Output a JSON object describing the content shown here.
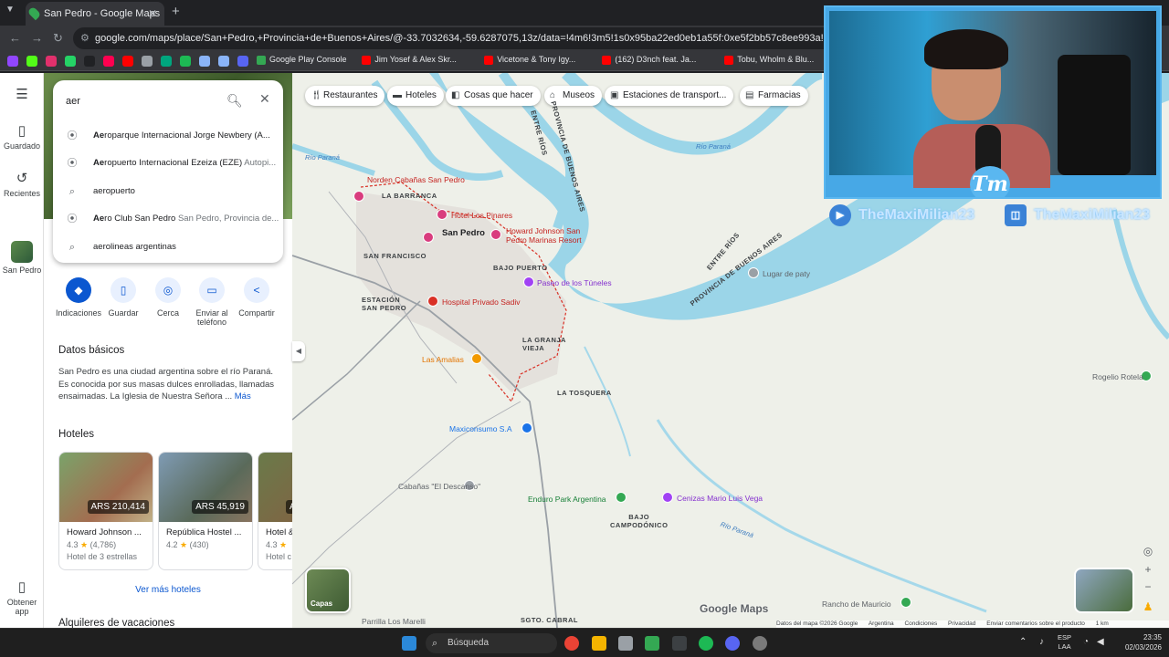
{
  "browser": {
    "tab_title": "San Pedro - Google Maps",
    "url": "google.com/maps/place/San+Pedro,+Provincia+de+Buenos+Aires/@-33.7032634,-59.6287075,13z/data=!4m6!3m5!1s0x95ba22ed0eb1a55f:0xe5f2bb57c8ee993a!8m2!3d-33.6757835!4d-59.6628",
    "bookmarks": [
      {
        "label": "",
        "color": "#9146ff"
      },
      {
        "label": "",
        "color": "#53fc18"
      },
      {
        "label": "",
        "color": "#e1306c"
      },
      {
        "label": "",
        "color": "#25d366"
      },
      {
        "label": "",
        "color": "#202124"
      },
      {
        "label": "",
        "color": "#ff0050"
      },
      {
        "label": "",
        "color": "#ff0000"
      },
      {
        "label": "",
        "color": "#9aa0a6"
      },
      {
        "label": "",
        "color": "#00a67e"
      },
      {
        "label": "",
        "color": "#1db954"
      },
      {
        "label": "",
        "color": "#8ab4f8"
      },
      {
        "label": "",
        "color": "#8ab4f8"
      },
      {
        "label": "",
        "color": "#5865f2"
      },
      {
        "label": "Google Play Console",
        "color": "#34a853"
      },
      {
        "label": "Jim Yosef & Alex Skr...",
        "color": "#ff0000"
      },
      {
        "label": "Vicetone & Tony Igy...",
        "color": "#ff0000"
      },
      {
        "label": "(162) D3nch feat. Ja...",
        "color": "#ff0000"
      },
      {
        "label": "Tobu, Wholm & Blu...",
        "color": "#ff0000"
      },
      {
        "label": "Joel Cor",
        "color": "#ff0000"
      }
    ]
  },
  "stream": {
    "youtube_handle": "TheMaxiMilian23",
    "twitch_handle": "TheMaxiMilian23",
    "logo_text": "Tm"
  },
  "rail": {
    "saved": "Guardado",
    "recent": "Recientes",
    "place": "San Pedro",
    "get_app": "Obtener app"
  },
  "search": {
    "value": "aer",
    "suggestions": [
      {
        "match": "Ae",
        "rest": "roparque Internacional Jorge Newbery (A...",
        "sub": "",
        "icon": "pin"
      },
      {
        "match": "Ae",
        "rest": "ropuerto Internacional Ezeiza (EZE) ",
        "sub": "Autopi...",
        "icon": "pin"
      },
      {
        "match": "ae",
        "rest": "ropuerto",
        "sub": "",
        "icon": "search"
      },
      {
        "match": "Ae",
        "rest": "ro Club San Pedro ",
        "sub": "San Pedro, Provincia de...",
        "icon": "pin"
      },
      {
        "match": "ae",
        "rest": "rolineas argentinas",
        "sub": "",
        "icon": "search"
      }
    ]
  },
  "actions": [
    {
      "label": "Indicaciones",
      "icon": "◆"
    },
    {
      "label": "Guardar",
      "icon": "▯"
    },
    {
      "label": "Cerca",
      "icon": "◎"
    },
    {
      "label": "Enviar al teléfono",
      "icon": "▭"
    },
    {
      "label": "Compartir",
      "icon": "<"
    }
  ],
  "basic": {
    "title": "Datos básicos",
    "text": "San Pedro es una ciudad argentina sobre el río Paraná. Es conocida por sus masas dulces enrolladas, llamadas ensaimadas. La Iglesia de Nuestra Señora ...",
    "more": "Más"
  },
  "hotels": {
    "title": "Hoteles",
    "items": [
      {
        "name": "Howard Johnson ...",
        "price": "ARS 210,414",
        "rating": "4.3",
        "reviews": "(4,786)",
        "kind": "Hotel de 3 estrellas"
      },
      {
        "name": "República Hostel ...",
        "price": "ARS 45,919",
        "rating": "4.2",
        "reviews": "(430)",
        "kind": ""
      },
      {
        "name": "Hotel & ...",
        "price": "A",
        "rating": "4.3",
        "reviews": "",
        "kind": "Hotel c"
      }
    ],
    "more": "Ver más hoteles"
  },
  "rentals_title": "Alquileres de vacaciones",
  "chips": [
    "Restaurantes",
    "Hoteles",
    "Cosas que hacer",
    "Museos",
    "Estaciones de transport..."
  ],
  "chips_last": "Farmacias",
  "map": {
    "labels": {
      "norden": "Norden Cabañas San Pedro",
      "la_barranca": "LA BARRANCA",
      "hotel_pinares": "Hotel Los Pinares",
      "san_pedro": "San Pedro",
      "howard": "Howard Johnson San\nPedro Marinas Resort",
      "san_francisco": "SAN FRANCISCO",
      "bajo_puerto": "BAJO PUERTO",
      "paseo": "Paseo de los Túneles",
      "estacion": "ESTACIÓN\nSAN PEDRO",
      "hospital": "Hospital Privado Sadiv",
      "granja": "LA GRANJA\nVIEJA",
      "amalias": "Las Amalias",
      "tosquera": "LA TOSQUERA",
      "maxiconsumo": "Maxiconsumo S.A",
      "descanso": "Cabañas \"El Descanso\"",
      "enduro": "Enduro Park Argentina",
      "cenizas": "Cenizas Mario Luis Vega",
      "bajo_campo": "BAJO\nCAMPODÓNICO",
      "lugar_paty": "Lugar de paty",
      "rogelio": "Rogelio Rotela",
      "mauricio": "Rancho de Mauricio",
      "parrilla": "Parrilla Los Marelli",
      "sgto": "SGTO. CABRAL",
      "entre_rios_1": "ENTRE RÍOS",
      "prov_ba_1": "PROVINCIA DE BUENOS AIRES",
      "entre_rios_2": "ENTRE RÍOS",
      "prov_ba_2": "PROVINCIA DE BUENOS AIRES",
      "rio_parana_1": "Río Paraná",
      "rio_parana_2": "Río Paraná",
      "rio_parana_3": "Río Paraná"
    },
    "layers": "Capas",
    "logo": "Google Maps",
    "attribution": [
      "Datos del mapa ©2026 Google",
      "Argentina",
      "Condiciones",
      "Privacidad",
      "Enviar comentarios sobre el producto",
      "1 km"
    ]
  },
  "taskbar": {
    "search": "Búsqueda",
    "lang_top": "ESP",
    "lang_bottom": "LAA",
    "time": "23:35",
    "date": "02/03/2026"
  }
}
